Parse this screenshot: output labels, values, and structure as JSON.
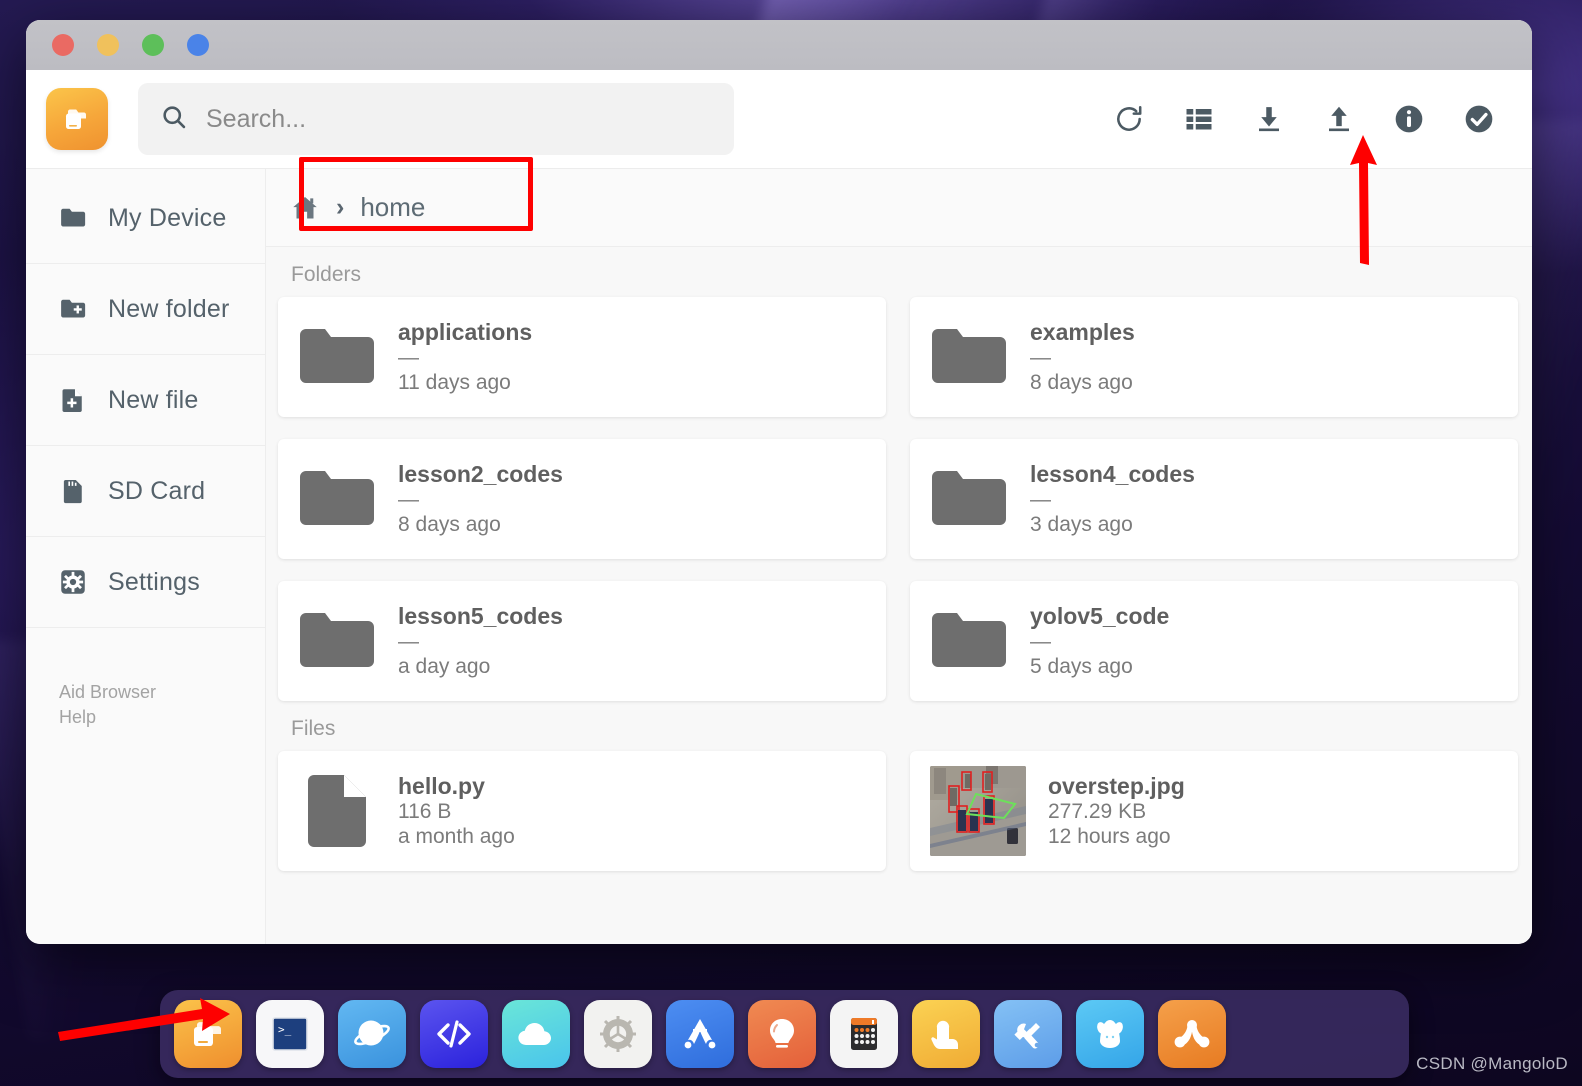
{
  "window": {
    "buttons": [
      {
        "name": "close",
        "color": "#ea6a63"
      },
      {
        "name": "minimize",
        "color": "#f0c15c"
      },
      {
        "name": "maximize",
        "color": "#5dbf5a"
      },
      {
        "name": "extra",
        "color": "#4a83e8"
      }
    ]
  },
  "header": {
    "app_icon": "files-app-icon",
    "search": {
      "placeholder": "Search...",
      "value": "",
      "icon": "search-icon"
    },
    "toolbar": [
      {
        "name": "refresh-icon",
        "label": "Refresh"
      },
      {
        "name": "list-view-icon",
        "label": "List view"
      },
      {
        "name": "download-icon",
        "label": "Download"
      },
      {
        "name": "upload-icon",
        "label": "Upload"
      },
      {
        "name": "info-icon",
        "label": "Info"
      },
      {
        "name": "check-circle-icon",
        "label": "Select"
      }
    ]
  },
  "sidebar": {
    "items": [
      {
        "label": "My Device",
        "icon": "folder-icon"
      },
      {
        "label": "New folder",
        "icon": "folder-plus-icon"
      },
      {
        "label": "New file",
        "icon": "file-plus-icon"
      },
      {
        "label": "SD Card",
        "icon": "sd-card-icon"
      },
      {
        "label": "Settings",
        "icon": "gear-icon"
      }
    ],
    "footer": {
      "line1": "Aid Browser",
      "line2": "Help"
    }
  },
  "breadcrumb": {
    "home_icon": "home-icon",
    "separator": "›",
    "path": "home"
  },
  "main": {
    "folders_label": "Folders",
    "files_label": "Files",
    "folders": [
      {
        "name": "applications",
        "size": "—",
        "time": "11 days ago",
        "icon": "folder-icon"
      },
      {
        "name": "examples",
        "size": "—",
        "time": "8 days ago",
        "icon": "folder-icon"
      },
      {
        "name": "lesson2_codes",
        "size": "—",
        "time": "8 days ago",
        "icon": "folder-icon"
      },
      {
        "name": "lesson4_codes",
        "size": "—",
        "time": "3 days ago",
        "icon": "folder-icon"
      },
      {
        "name": "lesson5_codes",
        "size": "—",
        "time": "a day ago",
        "icon": "folder-icon"
      },
      {
        "name": "yolov5_code",
        "size": "—",
        "time": "5 days ago",
        "icon": "folder-icon"
      }
    ],
    "files": [
      {
        "name": "hello.py",
        "size": "116 B",
        "time": "a month ago",
        "icon": "file-icon"
      },
      {
        "name": "overstep.jpg",
        "size": "277.29 KB",
        "time": "12 hours ago",
        "icon": "image-thumbnail"
      }
    ]
  },
  "dock": {
    "items": [
      {
        "name": "files-icon",
        "color": "#f5a93a"
      },
      {
        "name": "terminal-icon",
        "color": "#f5f5f7"
      },
      {
        "name": "browser-planet-icon",
        "color": "#46a5ea"
      },
      {
        "name": "code-editor-icon",
        "color": "#3a33e0"
      },
      {
        "name": "cloud-icon",
        "color": "#5fd6d0"
      },
      {
        "name": "settings-gear-icon",
        "color": "#f0f0ee"
      },
      {
        "name": "aid-logo-icon",
        "color": "#3a7ae8"
      },
      {
        "name": "lightbulb-icon",
        "color": "#ec7040"
      },
      {
        "name": "calculator-icon",
        "color": "#f2f2f2"
      },
      {
        "name": "touch-tap-icon",
        "color": "#f6c33f"
      },
      {
        "name": "tools-icon",
        "color": "#6fb0f0"
      },
      {
        "name": "mouse-icon",
        "color": "#44b8f0"
      },
      {
        "name": "node-graph-icon",
        "color": "#ef8b33"
      }
    ]
  },
  "annotations": {
    "box_color": "#fe0000",
    "arrow_color": "#fe0000",
    "highlighted_element": "breadcrumb",
    "arrow_targets": [
      "upload-icon",
      "files-dock-icon"
    ]
  },
  "watermark": "CSDN @MangoloD"
}
